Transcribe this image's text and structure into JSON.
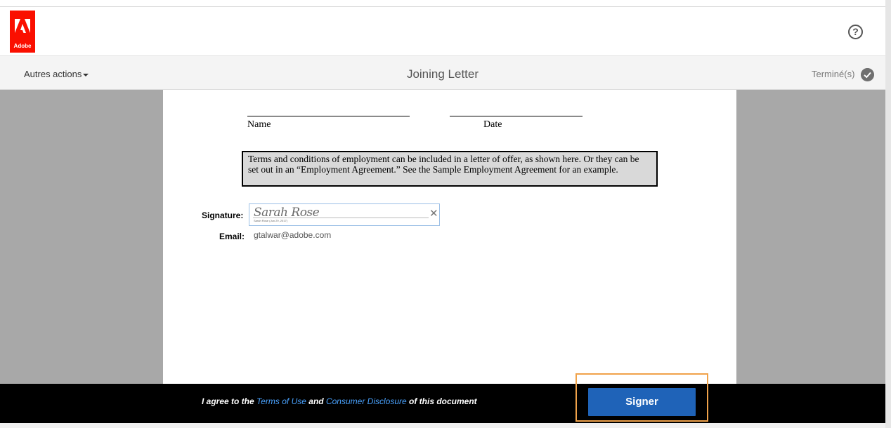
{
  "header": {
    "logo_text": "Adobe",
    "help_icon": "?"
  },
  "toolbar": {
    "more_actions_label": "Autres actions",
    "document_title": "Joining Letter",
    "done_label": "Terminé(s)"
  },
  "document": {
    "name_label": "Name",
    "date_label": "Date",
    "terms_text": "Terms and conditions of employment can be included in a letter of offer, as shown here. Or they can be set out in an “Employment Agreement.”  See the Sample Employment Agreement for an example.",
    "signature_label": "Signature:",
    "signature_script": "Sarah Rose",
    "signature_caption": "Sarah Rose   (Jun 29, 2017)",
    "email_label": "Email:",
    "email_value": "gtalwar@adobe.com"
  },
  "footer": {
    "agree_prefix": "I agree to the ",
    "terms_link": "Terms of Use",
    "agree_and": " and ",
    "disclosure_link": "Consumer Disclosure",
    "agree_suffix": " of this document",
    "sign_button_label": "Signer"
  },
  "colors": {
    "brand_red": "#fa0f00",
    "primary_blue": "#1f63b8",
    "link_blue": "#4aa3ff",
    "highlight_orange": "#f0a24a"
  }
}
